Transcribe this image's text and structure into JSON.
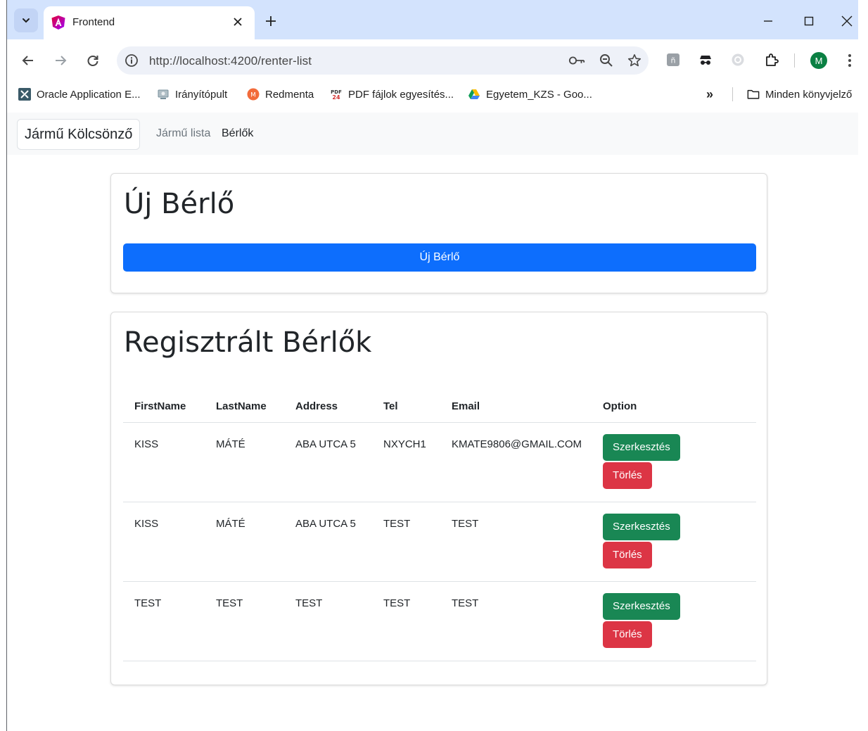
{
  "browser": {
    "tab_title": "Frontend",
    "url": "http://localhost:4200/renter-list",
    "profile_initial": "M",
    "bookmarks": [
      {
        "label": "Oracle Application E..."
      },
      {
        "label": "Irányítópult"
      },
      {
        "label": "Redmenta"
      },
      {
        "label": "PDF fájlok egyesítés..."
      },
      {
        "label": "Egyetem_KZS - Goo..."
      }
    ],
    "bookmarks_overflow": "»",
    "all_bookmarks": "Minden könyvjelző"
  },
  "navbar": {
    "brand": "Jármű Kölcsönző",
    "links": [
      "Jármű lista",
      "Bérlők"
    ]
  },
  "new_renter": {
    "heading": "Új Bérlő",
    "button": "Új Bérlő"
  },
  "renters": {
    "heading": "Regisztrált Bérlők",
    "columns": [
      "FirstName",
      "LastName",
      "Address",
      "Tel",
      "Email",
      "Option"
    ],
    "rows": [
      [
        "KISS",
        "MÁTÉ",
        "ABA UTCA 5",
        "NXYCH1",
        "KMATE9806@GMAIL.COM"
      ],
      [
        "KISS",
        "MÁTÉ",
        "ABA UTCA 5",
        "TEST",
        "TEST"
      ],
      [
        "TEST",
        "TEST",
        "TEST",
        "TEST",
        "TEST"
      ]
    ],
    "edit_label": "Szerkesztés",
    "delete_label": "Törlés"
  }
}
